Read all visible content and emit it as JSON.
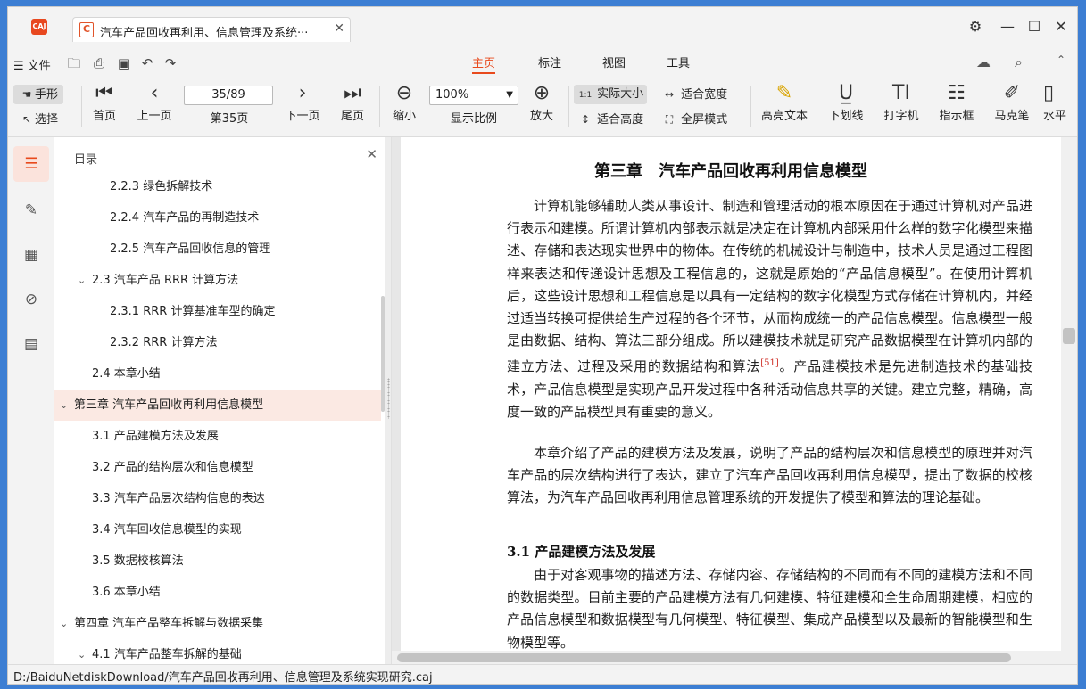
{
  "titlebar": {
    "logo_text": "CAJ",
    "tab_icon": "C",
    "tab_title": "汽车产品回收再利用、信息管理及系统···",
    "close_tab": "✕",
    "settings_icon": "⚙",
    "minimize": "—",
    "maximize": "☐",
    "close": "✕"
  },
  "menu": {
    "file": "☰ 文件",
    "tabs": [
      "主页",
      "标注",
      "视图",
      "工具"
    ],
    "active_tab": "主页"
  },
  "toolbar": {
    "hand": "手形",
    "select": "选择",
    "first_page": "首页",
    "prev_page": "上一页",
    "page_value": "35/89",
    "page_label": "第35页",
    "next_page": "下一页",
    "last_page": "尾页",
    "zoom_out": "缩小",
    "zoom_value": "100%",
    "zoom_label": "显示比例",
    "zoom_in": "放大",
    "actual_size_icon": "1:1",
    "actual_size": "实际大小",
    "fit_width": "适合宽度",
    "fit_height": "适合高度",
    "full_screen": "全屏模式",
    "highlight": "高亮文本",
    "underline": "下划线",
    "typewriter": "打字机",
    "indicator": "指示框",
    "marker": "马克笔",
    "watermark": "水平"
  },
  "toc": {
    "header": "目录",
    "items": [
      {
        "label": "2.2.3 绿色拆解技术",
        "level": 3
      },
      {
        "label": "2.2.4 汽车产品的再制造技术",
        "level": 3
      },
      {
        "label": "2.2.5 汽车产品回收信息的管理",
        "level": 3
      },
      {
        "label": "2.3 汽车产品 RRR 计算方法",
        "level": 2,
        "expanded": true
      },
      {
        "label": "2.3.1 RRR 计算基准车型的确定",
        "level": 3
      },
      {
        "label": "2.3.2 RRR 计算方法",
        "level": 3
      },
      {
        "label": "2.4 本章小结",
        "level": 2
      },
      {
        "label": "第三章 汽车产品回收再利用信息模型",
        "level": 1,
        "expanded": true,
        "selected": true
      },
      {
        "label": "3.1 产品建模方法及发展",
        "level": 2
      },
      {
        "label": "3.2 产品的结构层次和信息模型",
        "level": 2
      },
      {
        "label": "3.3 汽车产品层次结构信息的表达",
        "level": 2
      },
      {
        "label": "3.4 汽车回收信息模型的实现",
        "level": 2
      },
      {
        "label": "3.5 数据校核算法",
        "level": 2
      },
      {
        "label": "3.6 本章小结",
        "level": 2
      },
      {
        "label": "第四章 汽车产品整车拆解与数据采集",
        "level": 1,
        "expanded": true
      },
      {
        "label": "4.1 汽车产品整车拆解的基础",
        "level": 2,
        "expanded": true
      }
    ]
  },
  "document": {
    "chapter_title": "第三章　汽车产品回收再利用信息模型",
    "para1_a": "计算机能够辅助人类从事设计、制造和管理活动的根本原因在于通过计算机对产品进行表示和建模。所谓计算机内部表示就是决定在计算机内部采用什么样的数字化模型来描述、存储和表达现实世界中的物体。在传统的机械设计与制造中，技术人员是通过工程图样来表达和传递设计思想及工程信息的，这就是原始的“产品信息模型”。在使用计算机后，这些设计思想和工程信息是以具有一定结构的数字化模型方式存储在计算机内，并经过适当转换可提供给生产过程的各个环节，从而构成统一的产品信息模型。信息模型一般是由数据、结构、算法三部分组成。所以建模技术就是研究产品数据模型在计算机内部的建立方法、过程及采用的数据结构和算法",
    "para1_cite": "[51]",
    "para1_b": "。产品建模技术是先进制造技术的基础技术，产品信息模型是实现产品开发过程中各种活动信息共享的关键。建立完整，精确，高度一致的产品模型具有重要的意义。",
    "para2": "本章介绍了产品的建模方法及发展，说明了产品的结构层次和信息模型的原理并对汽车产品的层次结构进行了表达，建立了汽车产品回收再利用信息模型，提出了数据的校核算法，为汽车产品回收再利用信息管理系统的开发提供了模型和算法的理论基础。",
    "section_title": "3.1  产品建模方法及发展",
    "para3": "由于对客观事物的描述方法、存储内容、存储结构的不同而有不同的建模方法和不同的数据类型。目前主要的产品建模方法有几何建模、特征建模和全生命周期建模，相应的产品信息模型和数据模型有几何模型、特征模型、集成产品模型以及最新的智能模型和生物模型等。"
  },
  "status": {
    "path": "D:/BaiduNetdiskDownload/汽车产品回收再利用、信息管理及系统实现研究.caj"
  }
}
